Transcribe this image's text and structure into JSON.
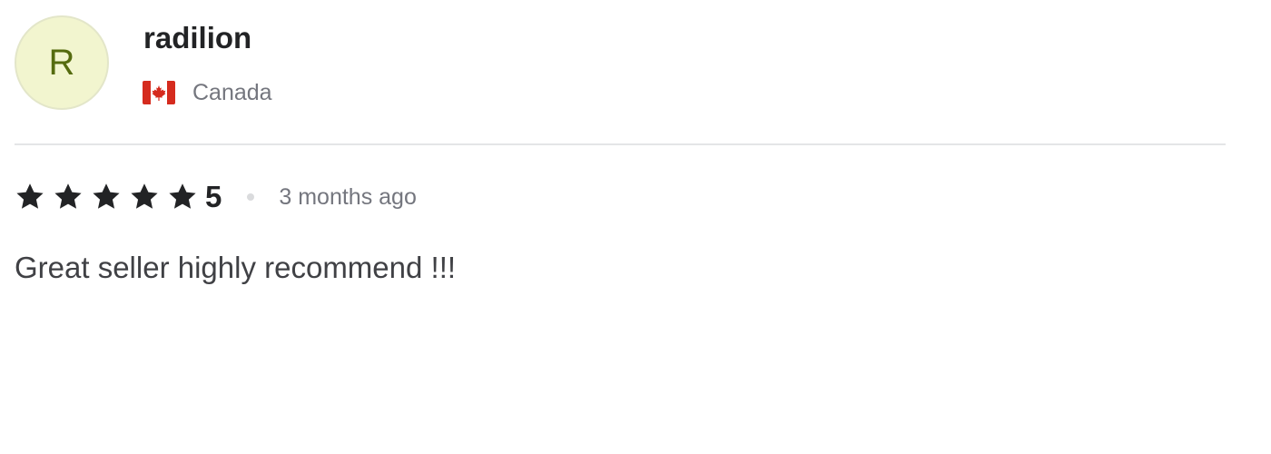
{
  "reviewer": {
    "avatar_initial": "R",
    "username": "radilion",
    "country": "Canada",
    "flag_icon": "canada-flag-icon"
  },
  "rating": {
    "stars": 5,
    "value": "5",
    "star_icon": "star-icon",
    "time_ago": "3 months ago"
  },
  "review_text": "Great seller highly recommend !!!",
  "colors": {
    "avatar_background": "#f2f5cf",
    "avatar_letter": "#556b0f",
    "primary_text": "#222325",
    "secondary_text": "#74767e",
    "divider": "#e4e5e7",
    "flag_red": "#d52b1e"
  }
}
